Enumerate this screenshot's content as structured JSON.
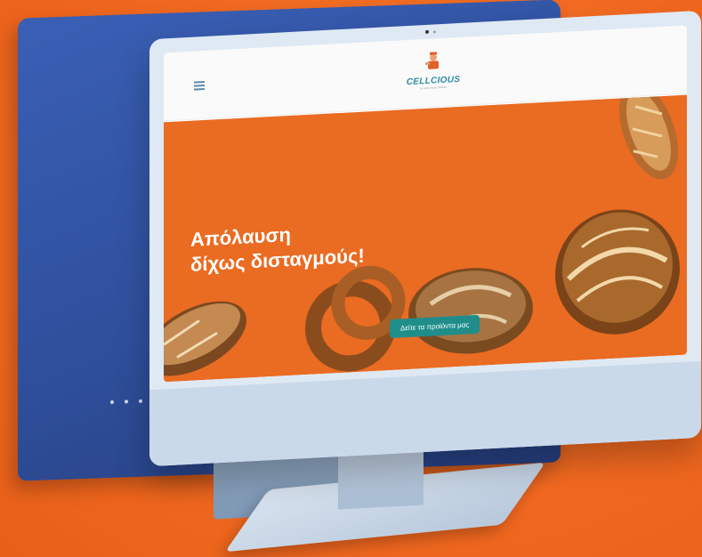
{
  "site": {
    "logo": {
      "name": "CELLCIOUS",
      "tagline": "so cells, many dreams"
    },
    "menu_icon": "hamburger-icon"
  },
  "hero": {
    "title_line1": "Απόλαυση",
    "title_line2": "δίχως δισταγμούς!",
    "cta_label": "Δείτε τα προϊόντα μας"
  },
  "colors": {
    "background": "#f26a21",
    "hero": "#ea6b22",
    "cta": "#1f8e8b",
    "back_monitor": "#2f4f9c",
    "front_monitor": "#dfe9f4"
  },
  "images": [
    "bread-loaf",
    "sesame-bagel-ring",
    "seeded-bread",
    "round-sourdough",
    "tall-bread"
  ]
}
